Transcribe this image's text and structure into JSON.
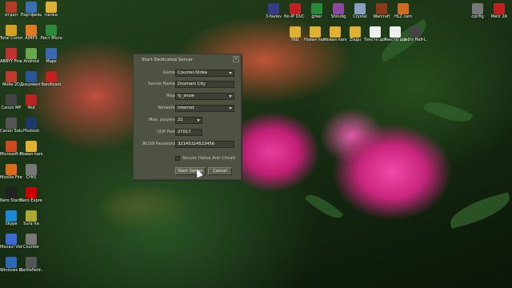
{
  "desktop": {
    "left_column": [
      {
        "label": "отдел",
        "color": "#b53a2a"
      },
      {
        "label": "Портфель",
        "color": "#3a6fb5"
      },
      {
        "label": "Total Comman",
        "color": "#d4a020"
      },
      {
        "label": "AIMP3",
        "color": "#e07a20"
      },
      {
        "label": "ABBYY Fine Re",
        "color": "#c23030"
      },
      {
        "label": "Android",
        "color": "#6aa84f"
      },
      {
        "label": "Moile 2D",
        "color": "#c0392b"
      },
      {
        "label": "Документ Microsoft",
        "color": "#2a5599"
      },
      {
        "label": "Canon MP",
        "color": "#444"
      },
      {
        "label": "4kd",
        "color": "#b22"
      },
      {
        "label": "Canon Solution",
        "color": "#555"
      },
      {
        "label": "Photosh",
        "color": "#1a3a6a"
      },
      {
        "label": "Microsoft Office",
        "color": "#d04a1e"
      },
      {
        "label": "Новая папка CD",
        "color": "#e0b030"
      },
      {
        "label": "Mozilla Firefox",
        "color": "#e06a1a"
      },
      {
        "label": "CHtS",
        "color": "#777"
      },
      {
        "label": "Nero StartSmart",
        "color": "#222"
      },
      {
        "label": "Nero Express",
        "color": "#c00"
      },
      {
        "label": "Skype",
        "color": "#1a8ad4"
      },
      {
        "label": "Sura Ira",
        "color": "#aa3"
      },
      {
        "label": "Movavi Video",
        "color": "#3a6ad4"
      },
      {
        "label": "Counter",
        "color": "#777"
      },
      {
        "label": "Windows Live Call",
        "color": "#2a6ab4"
      },
      {
        "label": "Battlefield Arcade",
        "color": "#555"
      }
    ],
    "col2": [
      {
        "label": "папка",
        "color": "#e0b030"
      },
      {
        "label": "Лист Micros",
        "color": "#2a8a3a"
      },
      {
        "label": "Maps",
        "color": "#3a6ab4"
      },
      {
        "label": "Bandicam",
        "color": "#c02020"
      }
    ],
    "top_row": [
      {
        "label": "3-faviev",
        "color": "#3a3a8a"
      },
      {
        "label": "No-IP DUC 2.2.1 w",
        "color": "#c02020"
      },
      {
        "label": "greer",
        "color": "#2a8a3a"
      },
      {
        "label": "Shindig",
        "color": "#8a4aa0"
      },
      {
        "label": "Crystal",
        "color": "#8aa0c0"
      },
      {
        "label": "Warcraft",
        "color": "#8a3a1a"
      },
      {
        "label": "HL2 cam",
        "color": "#d06a20"
      },
      {
        "label": "config",
        "color": "#777"
      },
      {
        "label": "Meilr 2A",
        "color": "#c02020"
      }
    ],
    "second_row": [
      {
        "label": "Hdz",
        "color": "#e0b030"
      },
      {
        "label": "Новая папка (4)",
        "color": "#e0b030"
      },
      {
        "label": "Новая папка",
        "color": "#e0b030"
      },
      {
        "label": "Zlagu",
        "color": "#e0b030"
      },
      {
        "label": "Тексто документ",
        "color": "#eee"
      },
      {
        "label": "Тексто документ",
        "color": "#eee"
      },
      {
        "label": "Jeb's Half-L",
        "color": "#444"
      }
    ]
  },
  "dialog": {
    "title": "Start Dedicated Server",
    "close_glyph": "×",
    "fields": {
      "game_label": "Game",
      "game_value": "Counter-Strike",
      "server_name_label": "Server Name",
      "server_name_value": "Dusmani City",
      "map_label": "Map",
      "map_value": "fy_snow",
      "network_label": "Network",
      "network_value": "Internet",
      "max_players_label": "Max. players",
      "max_players_value": "22",
      "udp_port_label": "UDP Port",
      "udp_port_value": "27017",
      "rcon_label": "RCON Password",
      "rcon_value": "32145324523456"
    },
    "secure_label": "Secure (Valve Anti-Cheat)",
    "secure_checked": false,
    "start_button": "Start Server",
    "cancel_button": "Cancel"
  }
}
